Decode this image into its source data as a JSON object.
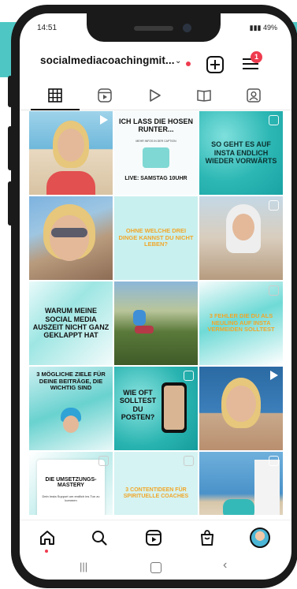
{
  "status_bar": {
    "time": "14:51",
    "battery": "49%"
  },
  "header": {
    "username": "socialmediacoachingmit...",
    "notification_count": "1"
  },
  "tabs": [
    "grid",
    "reels",
    "play",
    "guides",
    "tagged"
  ],
  "grid": [
    {
      "caption": "",
      "kind": "video"
    },
    {
      "caption": "ICH LASS DIE HOSEN RUNTER...",
      "sub": "MEHR INFOS IN DER CAPTION",
      "footer": "LIVE: SAMSTAG 10UHR",
      "kind": "image"
    },
    {
      "caption": "SO GEHT ES AUF INSTA ENDLICH WIEDER VORWÄRTS",
      "kind": "reel"
    },
    {
      "caption": "",
      "kind": "image"
    },
    {
      "caption": "OHNE WELCHE DREI DINGE KANNST DU NICHT LEBEN?",
      "kind": "image"
    },
    {
      "caption": "",
      "kind": "reel"
    },
    {
      "caption": "WARUM MEINE SOCIAL MEDIA AUSZEIT NICHT GANZ GEKLAPPT HAT",
      "kind": "image"
    },
    {
      "caption": "",
      "kind": "image"
    },
    {
      "caption": "3 FEHLER DIE DU ALS NEULING AUF INSTA VERMEIDEN SOLLTEST",
      "kind": "image"
    },
    {
      "caption": "3 MÖGLICHE ZIELE FÜR DEINE BEITRÄGE, DIE WICHTIG SIND",
      "kind": "image"
    },
    {
      "caption": "WIE OFT SOLLTEST DU POSTEN?",
      "kind": "reel"
    },
    {
      "caption": "",
      "kind": "video"
    },
    {
      "caption": "DIE UMSETZUNGS-MASTERY",
      "sub": "Dein Insta Support um endlich ins Tun zu kommen",
      "kind": "image"
    },
    {
      "caption": "3 CONTENTIDEEN FÜR SPIRITUELLE COACHES",
      "kind": "image"
    },
    {
      "caption": "",
      "kind": "reel"
    }
  ],
  "bottom_nav": [
    "home",
    "search",
    "reels",
    "shop",
    "profile"
  ],
  "colors": {
    "accent_red": "#ef3b4f",
    "teal": "#2cb7b4",
    "brand_band": "#4ec7c4"
  }
}
